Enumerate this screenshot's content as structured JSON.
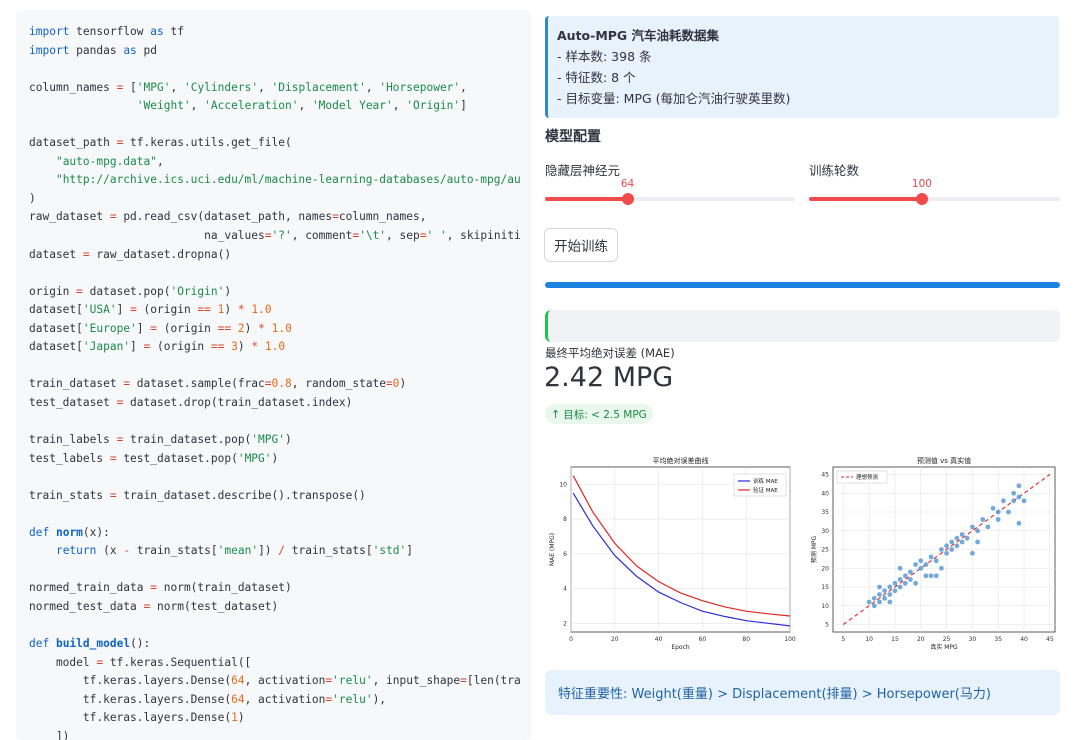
{
  "code": {
    "lines": [
      [
        [
          "kw",
          "import"
        ],
        [
          "p",
          " tensorflow "
        ],
        [
          "kw",
          "as"
        ],
        [
          "p",
          " tf"
        ]
      ],
      [
        [
          "kw",
          "import"
        ],
        [
          "p",
          " pandas "
        ],
        [
          "kw",
          "as"
        ],
        [
          "p",
          " pd"
        ]
      ],
      [],
      [
        [
          "p",
          "column_names "
        ],
        [
          "op",
          "="
        ],
        [
          "p",
          " ["
        ],
        [
          "str",
          "'MPG'"
        ],
        [
          "p",
          ", "
        ],
        [
          "str",
          "'Cylinders'"
        ],
        [
          "p",
          ", "
        ],
        [
          "str",
          "'Displacement'"
        ],
        [
          "p",
          ", "
        ],
        [
          "str",
          "'Horsepower'"
        ],
        [
          "p",
          ","
        ]
      ],
      [
        [
          "p",
          "                "
        ],
        [
          "str",
          "'Weight'"
        ],
        [
          "p",
          ", "
        ],
        [
          "str",
          "'Acceleration'"
        ],
        [
          "p",
          ", "
        ],
        [
          "str",
          "'Model Year'"
        ],
        [
          "p",
          ", "
        ],
        [
          "str",
          "'Origin'"
        ],
        [
          "p",
          "]"
        ]
      ],
      [],
      [
        [
          "p",
          "dataset_path "
        ],
        [
          "op",
          "="
        ],
        [
          "p",
          " tf.keras.utils.get_file("
        ]
      ],
      [
        [
          "p",
          "    "
        ],
        [
          "str",
          "\"auto-mpg.data\""
        ],
        [
          "p",
          ","
        ]
      ],
      [
        [
          "p",
          "    "
        ],
        [
          "str",
          "\"http://archive.ics.uci.edu/ml/machine-learning-databases/auto-mpg/au"
        ]
      ],
      [
        [
          "p",
          ")"
        ]
      ],
      [
        [
          "p",
          "raw_dataset "
        ],
        [
          "op",
          "="
        ],
        [
          "p",
          " pd.read_csv(dataset_path, names"
        ],
        [
          "op",
          "="
        ],
        [
          "p",
          "column_names,"
        ]
      ],
      [
        [
          "p",
          "                          na_values"
        ],
        [
          "op",
          "="
        ],
        [
          "str",
          "'?'"
        ],
        [
          "p",
          ", comment"
        ],
        [
          "op",
          "="
        ],
        [
          "str",
          "'\\t'"
        ],
        [
          "p",
          ", sep"
        ],
        [
          "op",
          "="
        ],
        [
          "str",
          "' '"
        ],
        [
          "p",
          ", skipiniti"
        ]
      ],
      [
        [
          "p",
          "dataset "
        ],
        [
          "op",
          "="
        ],
        [
          "p",
          " raw_dataset.dropna()"
        ]
      ],
      [],
      [
        [
          "p",
          "origin "
        ],
        [
          "op",
          "="
        ],
        [
          "p",
          " dataset.pop("
        ],
        [
          "str",
          "'Origin'"
        ],
        [
          "p",
          ")"
        ]
      ],
      [
        [
          "p",
          "dataset["
        ],
        [
          "str",
          "'USA'"
        ],
        [
          "p",
          "] "
        ],
        [
          "op",
          "="
        ],
        [
          "p",
          " (origin "
        ],
        [
          "op",
          "=="
        ],
        [
          "p",
          " "
        ],
        [
          "num",
          "1"
        ],
        [
          "p",
          ") "
        ],
        [
          "op",
          "*"
        ],
        [
          "p",
          " "
        ],
        [
          "num",
          "1.0"
        ]
      ],
      [
        [
          "p",
          "dataset["
        ],
        [
          "str",
          "'Europe'"
        ],
        [
          "p",
          "] "
        ],
        [
          "op",
          "="
        ],
        [
          "p",
          " (origin "
        ],
        [
          "op",
          "=="
        ],
        [
          "p",
          " "
        ],
        [
          "num",
          "2"
        ],
        [
          "p",
          ") "
        ],
        [
          "op",
          "*"
        ],
        [
          "p",
          " "
        ],
        [
          "num",
          "1.0"
        ]
      ],
      [
        [
          "p",
          "dataset["
        ],
        [
          "str",
          "'Japan'"
        ],
        [
          "p",
          "] "
        ],
        [
          "op",
          "="
        ],
        [
          "p",
          " (origin "
        ],
        [
          "op",
          "=="
        ],
        [
          "p",
          " "
        ],
        [
          "num",
          "3"
        ],
        [
          "p",
          ") "
        ],
        [
          "op",
          "*"
        ],
        [
          "p",
          " "
        ],
        [
          "num",
          "1.0"
        ]
      ],
      [],
      [
        [
          "p",
          "train_dataset "
        ],
        [
          "op",
          "="
        ],
        [
          "p",
          " dataset.sample(frac"
        ],
        [
          "op",
          "="
        ],
        [
          "num",
          "0.8"
        ],
        [
          "p",
          ", random_state"
        ],
        [
          "op",
          "="
        ],
        [
          "num",
          "0"
        ],
        [
          "p",
          ")"
        ]
      ],
      [
        [
          "p",
          "test_dataset "
        ],
        [
          "op",
          "="
        ],
        [
          "p",
          " dataset.drop(train_dataset.index)"
        ]
      ],
      [],
      [
        [
          "p",
          "train_labels "
        ],
        [
          "op",
          "="
        ],
        [
          "p",
          " train_dataset.pop("
        ],
        [
          "str",
          "'MPG'"
        ],
        [
          "p",
          ")"
        ]
      ],
      [
        [
          "p",
          "test_labels "
        ],
        [
          "op",
          "="
        ],
        [
          "p",
          " test_dataset.pop("
        ],
        [
          "str",
          "'MPG'"
        ],
        [
          "p",
          ")"
        ]
      ],
      [],
      [
        [
          "p",
          "train_stats "
        ],
        [
          "op",
          "="
        ],
        [
          "p",
          " train_dataset.describe().transpose()"
        ]
      ],
      [],
      [
        [
          "kw",
          "def"
        ],
        [
          "p",
          " "
        ],
        [
          "fn",
          "norm"
        ],
        [
          "p",
          "(x):"
        ]
      ],
      [
        [
          "p",
          "    "
        ],
        [
          "kw",
          "return"
        ],
        [
          "p",
          " (x "
        ],
        [
          "op",
          "-"
        ],
        [
          "p",
          " train_stats["
        ],
        [
          "str",
          "'mean'"
        ],
        [
          "p",
          "]) "
        ],
        [
          "op",
          "/"
        ],
        [
          "p",
          " train_stats["
        ],
        [
          "str",
          "'std'"
        ],
        [
          "p",
          "]"
        ]
      ],
      [],
      [
        [
          "p",
          "normed_train_data "
        ],
        [
          "op",
          "="
        ],
        [
          "p",
          " norm(train_dataset)"
        ]
      ],
      [
        [
          "p",
          "normed_test_data "
        ],
        [
          "op",
          "="
        ],
        [
          "p",
          " norm(test_dataset)"
        ]
      ],
      [],
      [
        [
          "kw",
          "def"
        ],
        [
          "p",
          " "
        ],
        [
          "fn",
          "build_model"
        ],
        [
          "p",
          "():"
        ]
      ],
      [
        [
          "p",
          "    model "
        ],
        [
          "op",
          "="
        ],
        [
          "p",
          " tf.keras.Sequential(["
        ]
      ],
      [
        [
          "p",
          "        tf.keras.layers.Dense("
        ],
        [
          "num",
          "64"
        ],
        [
          "p",
          ", activation"
        ],
        [
          "op",
          "="
        ],
        [
          "str",
          "'relu'"
        ],
        [
          "p",
          ", input_shape"
        ],
        [
          "op",
          "="
        ],
        [
          "p",
          "[len(tra"
        ]
      ],
      [
        [
          "p",
          "        tf.keras.layers.Dense("
        ],
        [
          "num",
          "64"
        ],
        [
          "p",
          ", activation"
        ],
        [
          "op",
          "="
        ],
        [
          "str",
          "'relu'"
        ],
        [
          "p",
          "),"
        ]
      ],
      [
        [
          "p",
          "        tf.keras.layers.Dense("
        ],
        [
          "num",
          "1"
        ],
        [
          "p",
          ")"
        ]
      ],
      [
        [
          "p",
          "    ])"
        ]
      ]
    ]
  },
  "info": {
    "title": "Auto-MPG 汽车油耗数据集",
    "line1": "- 样本数: 398 条",
    "line2": "- 特征数: 8 个",
    "line3": "- 目标变量: MPG (每加仑汽油行驶英里数)"
  },
  "config": {
    "title": "模型配置",
    "hidden_label": "隐藏层神经元",
    "hidden_value": "64",
    "hidden_fraction": 0.33,
    "epochs_label": "训练轮数",
    "epochs_value": "100",
    "epochs_fraction": 0.45
  },
  "train_button": "开始训练",
  "progress_fraction": 1.0,
  "metric": {
    "label": "最终平均绝对误差 (MAE)",
    "value": "2.42 MPG",
    "delta_arrow": "↑",
    "delta": "目标: < 2.5 MPG"
  },
  "colors": {
    "accent": "#1c83e1",
    "slider": "#ef4b4b",
    "success": "#21c354",
    "train_line": "#2c2cd6",
    "val_line": "#e02626",
    "scatter": "#5b9bd5"
  },
  "chart_data": [
    {
      "type": "line",
      "title": "平均绝对误差曲线",
      "xlabel": "Epoch",
      "ylabel": "MAE (MPG)",
      "xlim": [
        0,
        100
      ],
      "ylim": [
        1.5,
        11
      ],
      "xticks": [
        "0",
        "20",
        "40",
        "60",
        "80",
        "100"
      ],
      "yticks": [
        "2",
        "4",
        "6",
        "8",
        "10"
      ],
      "legend_position": "upper-right",
      "series": [
        {
          "name": "训练 MAE",
          "x": [
            1,
            10,
            20,
            30,
            40,
            50,
            60,
            70,
            80,
            90,
            100
          ],
          "y": [
            9.5,
            7.6,
            5.9,
            4.7,
            3.8,
            3.2,
            2.7,
            2.4,
            2.15,
            2.0,
            1.85
          ]
        },
        {
          "name": "验证 MAE",
          "x": [
            1,
            10,
            20,
            30,
            40,
            50,
            60,
            70,
            80,
            90,
            100
          ],
          "y": [
            10.5,
            8.4,
            6.6,
            5.3,
            4.4,
            3.75,
            3.3,
            2.95,
            2.7,
            2.55,
            2.42
          ]
        }
      ]
    },
    {
      "type": "scatter",
      "title": "预测值 vs 真实值",
      "xlabel": "真实 MPG",
      "ylabel": "预测 MPG",
      "xlim": [
        3,
        46
      ],
      "ylim": [
        3,
        47
      ],
      "xticks": [
        "5",
        "10",
        "15",
        "20",
        "25",
        "30",
        "35",
        "40",
        "45"
      ],
      "yticks": [
        "5",
        "10",
        "15",
        "20",
        "25",
        "30",
        "35",
        "40",
        "45"
      ],
      "legend_position": "upper-left",
      "reference_line": {
        "name": "理想预测",
        "from": [
          5,
          5
        ],
        "to": [
          45,
          45
        ]
      },
      "points": [
        [
          10,
          11
        ],
        [
          11,
          10
        ],
        [
          11,
          12
        ],
        [
          12,
          11
        ],
        [
          12,
          13
        ],
        [
          13,
          12
        ],
        [
          13,
          14
        ],
        [
          14,
          13
        ],
        [
          14,
          11
        ],
        [
          14,
          15
        ],
        [
          15,
          14
        ],
        [
          15,
          16
        ],
        [
          16,
          15
        ],
        [
          16,
          17
        ],
        [
          17,
          18
        ],
        [
          17,
          16
        ],
        [
          18,
          17
        ],
        [
          18,
          19
        ],
        [
          19,
          21
        ],
        [
          19,
          16
        ],
        [
          20,
          20
        ],
        [
          20,
          22
        ],
        [
          21,
          21
        ],
        [
          21,
          18
        ],
        [
          22,
          23
        ],
        [
          23,
          22
        ],
        [
          23,
          18
        ],
        [
          24,
          25
        ],
        [
          25,
          24
        ],
        [
          25,
          26
        ],
        [
          26,
          25
        ],
        [
          26,
          27
        ],
        [
          27,
          28
        ],
        [
          27,
          26
        ],
        [
          28,
          29
        ],
        [
          28,
          27
        ],
        [
          29,
          28
        ],
        [
          30,
          31
        ],
        [
          31,
          30
        ],
        [
          31,
          27
        ],
        [
          32,
          33
        ],
        [
          33,
          31
        ],
        [
          34,
          36
        ],
        [
          35,
          35
        ],
        [
          35,
          33
        ],
        [
          36,
          38
        ],
        [
          37,
          35
        ],
        [
          38,
          40
        ],
        [
          38,
          38
        ],
        [
          39,
          39
        ],
        [
          39,
          42
        ],
        [
          39,
          32
        ],
        [
          40,
          38
        ],
        [
          12,
          15
        ],
        [
          16,
          20
        ],
        [
          22,
          18
        ],
        [
          30,
          24
        ],
        [
          24,
          20
        ]
      ]
    }
  ],
  "feature": "特征重要性: Weight(重量) > Displacement(排量) > Horsepower(马力)"
}
